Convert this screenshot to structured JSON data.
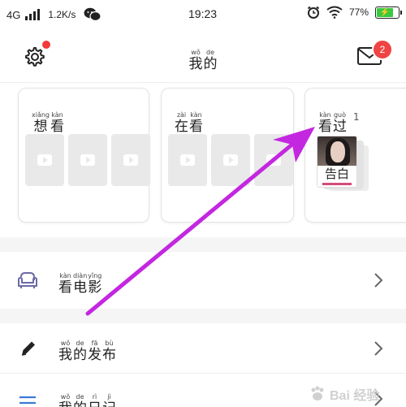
{
  "status_bar": {
    "network": "4G",
    "speed": "1.2K/s",
    "time": "19:23",
    "battery": "77%"
  },
  "header": {
    "title": [
      {
        "py": "wǒ",
        "hz": "我"
      },
      {
        "py": "de",
        "hz": "的"
      }
    ],
    "mail_badge": "2"
  },
  "cards": {
    "want": {
      "title": [
        {
          "py": "xiǎng",
          "hz": "想"
        },
        {
          "py": "kàn",
          "hz": "看"
        }
      ]
    },
    "watching": {
      "title": [
        {
          "py": "zài",
          "hz": "在"
        },
        {
          "py": "kàn",
          "hz": "看"
        }
      ]
    },
    "watched": {
      "title": [
        {
          "py": "kàn",
          "hz": "看"
        },
        {
          "py": "guò",
          "hz": "过"
        }
      ],
      "count": "1",
      "poster_title": "告白"
    }
  },
  "menu": [
    {
      "label": [
        {
          "py": "kàn",
          "hz": "看"
        },
        {
          "py": "diàn",
          "hz": "电"
        },
        {
          "py": "yǐng",
          "hz": "影"
        }
      ],
      "icon": "sofa-icon"
    },
    {
      "label": [
        {
          "py": "wǒ",
          "hz": "我"
        },
        {
          "py": "de",
          "hz": "的"
        },
        {
          "py": "fā",
          "hz": "发"
        },
        {
          "py": "bù",
          "hz": "布"
        }
      ],
      "icon": "pencil-icon"
    },
    {
      "label": [
        {
          "py": "wǒ",
          "hz": "我"
        },
        {
          "py": "de",
          "hz": "的"
        },
        {
          "py": "rì",
          "hz": "日"
        },
        {
          "py": "jì",
          "hz": "记"
        }
      ],
      "icon": "list-icon"
    }
  ],
  "colors": {
    "accent_purple": "#c327e0",
    "badge_red": "#f04343",
    "battery_green": "#38c93f",
    "sofa_icon": "#6c6aa8"
  },
  "watermark": "Bai 经验"
}
